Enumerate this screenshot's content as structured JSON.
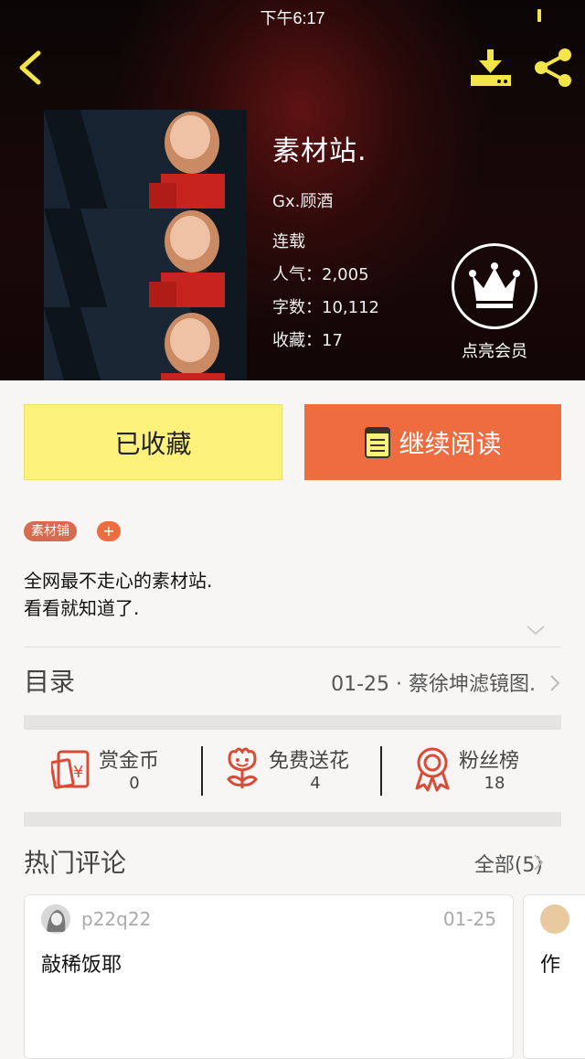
{
  "status_bar": {
    "time": "下午6:17"
  },
  "book": {
    "title": "素材站.",
    "author": "Gx.顾酒",
    "status": "连载",
    "popularity_label": "人气：",
    "popularity": "2,005",
    "words_label": "字数：",
    "words": "10,112",
    "favorites_label": "收藏：",
    "favorites": "17"
  },
  "vip": {
    "label": "点亮会员"
  },
  "actions": {
    "collected": "已收藏",
    "continue_reading": "继续阅读"
  },
  "tags": [
    {
      "label": "素材铺"
    }
  ],
  "tag_add": "+",
  "description": [
    "全网最不走心的素材站.",
    "看看就知道了."
  ],
  "catalog": {
    "label": "目录",
    "latest": "01-25 · 蔡徐坤滤镜图."
  },
  "stats": [
    {
      "icon": "red-envelope-icon",
      "label": "赏金币",
      "value": "0"
    },
    {
      "icon": "flower-icon",
      "label": "免费送花",
      "value": "4"
    },
    {
      "icon": "medal-icon",
      "label": "粉丝榜",
      "value": "18"
    }
  ],
  "comments": {
    "title": "热门评论",
    "all": "全部(5)",
    "items": [
      {
        "user": "p22q22",
        "date": "01-25",
        "text": "敲稀饭耶"
      },
      {
        "user": "",
        "date": "",
        "text": "作"
      }
    ]
  },
  "colors": {
    "accent_yellow": "#fbf17b",
    "accent_orange": "#ee6c40",
    "icon_yellow": "#f3e44a",
    "icon_red": "#d94b36"
  }
}
